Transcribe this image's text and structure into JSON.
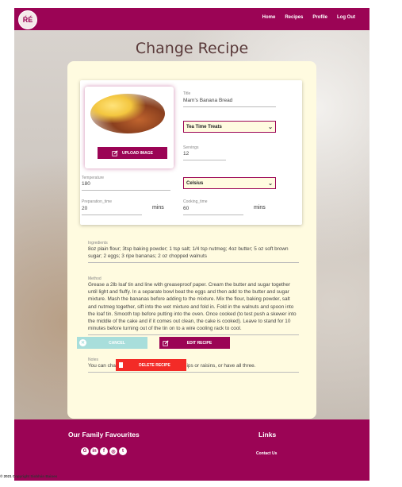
{
  "nav": {
    "logo_text": "ŔÉ",
    "links": [
      "Home",
      "Recipes",
      "Profile",
      "Log Out"
    ]
  },
  "page": {
    "heading": "Change Recipe"
  },
  "form": {
    "upload_label": "UPLOAD IMAGE",
    "title_label": "Title",
    "title_value": "Mam's Banana Bread",
    "category_value": "Tea Time Treats",
    "servings_label": "Servings",
    "servings_value": "12",
    "temperature_label": "Temperature",
    "temperature_value": "180",
    "temperature_unit": "Celsius",
    "prep_label": "Preparation_time",
    "prep_value": "20",
    "cook_label": "Cooking_time",
    "cook_value": "60",
    "mins": "mins",
    "ingredients_label": "Ingredients",
    "ingredients_value": "8oz plain flour; 3tsp baking powder; 1 tsp salt; 1/4 tsp nutmeg; 4oz butter; 5 oz soft brown sugar; 2 eggs; 3 ripe bananas; 2 oz chopped walnuts",
    "method_label": "Method",
    "method_value": "Grease a 2lb loaf tin and line with greaseproof paper. Cream the butter and sugar together until light and fluffy. In a separate bowl beat the eggs and then add to the butter and sugar mixture. Mash the bananas before adding to the mixture. Mix the flour, baking powder, salt and nutmeg together, sift into the wet mixture and fold in. Fold in the walnuts and spoon into the loaf tin. Smooth top before putting into the oven. Once cooked (to test push a skewer into the middle of the cake and if it comes out clean, the cake is cooked). Leave to stand for 10 minutes before turning out of the tin on to a wire cooling rack to cool.",
    "notes_label": "Notes",
    "notes_value": "You can change the walnuts to chocolate chips or raisins, or have all three."
  },
  "buttons": {
    "cancel": "CANCEL",
    "edit": "EDIT RECIPE",
    "delete": "DELETE RECIPE"
  },
  "footer": {
    "favourites_title": "Our Family Favourites",
    "links_title": "Links",
    "contact": "Contact Us",
    "socials": [
      "github-icon",
      "linkedin-icon",
      "facebook-icon",
      "instagram-icon",
      "twitter-icon"
    ],
    "copyright": "© 2021 Copyright Siobhán Baines"
  },
  "colors": {
    "brand": "#9b0455",
    "cancel": "#a8dedb",
    "delete": "#f32b27",
    "card": "#fffbe0"
  }
}
